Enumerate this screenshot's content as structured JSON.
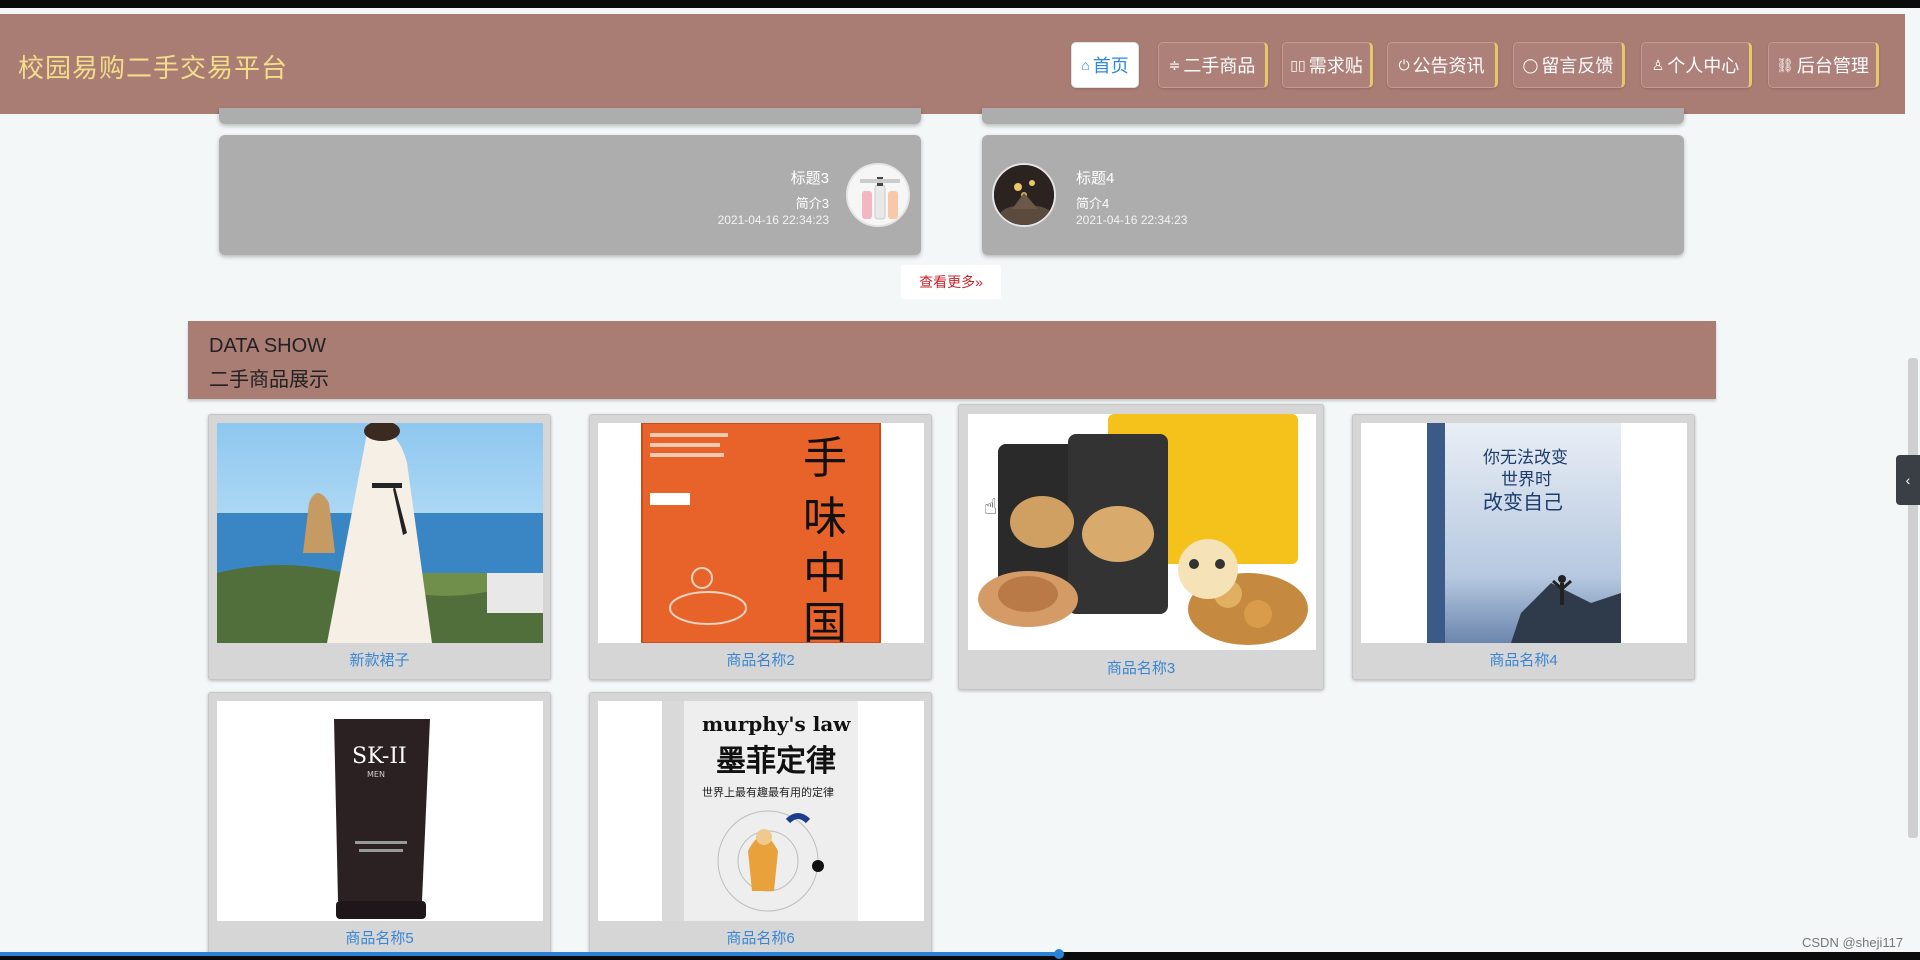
{
  "header": {
    "brand": "校园易购二手交易平台",
    "nav": [
      {
        "label": "首页",
        "icon": "⌂",
        "active": true
      },
      {
        "label": "二手商品",
        "icon": "≑"
      },
      {
        "label": "需求贴",
        "icon": "▯▯"
      },
      {
        "label": "公告资讯",
        "icon": "⏻"
      },
      {
        "label": "留言反馈",
        "icon": "◯"
      },
      {
        "label": "个人中心",
        "icon": "♙"
      },
      {
        "label": "后台管理",
        "icon": "⛓"
      }
    ]
  },
  "news": [
    {
      "title": "标题3",
      "summary": "简介3",
      "date": "2021-04-16 22:34:23"
    },
    {
      "title": "标题4",
      "summary": "简介4",
      "date": "2021-04-16 22:34:23"
    }
  ],
  "more_label": "查看更多",
  "more_icon": "»",
  "section": {
    "title_en": "DATA SHOW",
    "title_cn": "二手商品展示"
  },
  "products": [
    {
      "name": "新款裙子"
    },
    {
      "name": "商品名称2"
    },
    {
      "name": "商品名称3"
    },
    {
      "name": "商品名称4"
    },
    {
      "name": "商品名称5"
    },
    {
      "name": "商品名称6"
    }
  ],
  "watermark": "CSDN @sheji117",
  "side_tab_icon": "‹"
}
